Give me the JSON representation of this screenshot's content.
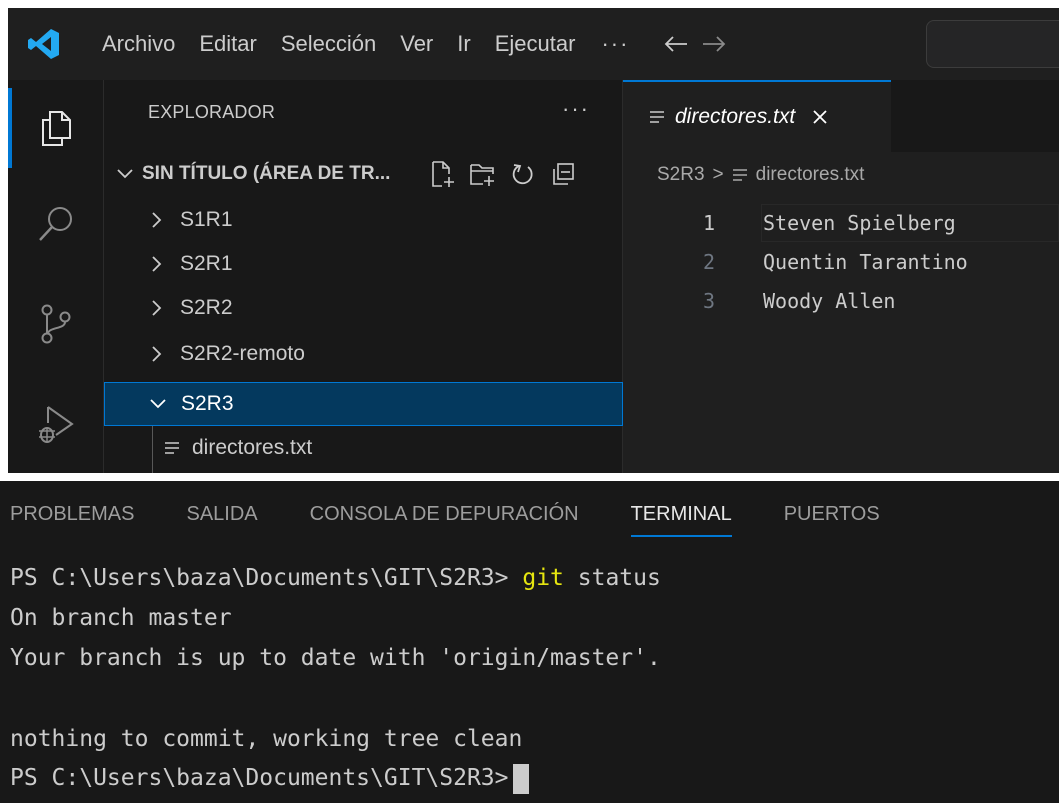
{
  "titlebar": {
    "menu": [
      "Archivo",
      "Editar",
      "Selección",
      "Ver",
      "Ir",
      "Ejecutar"
    ],
    "more": "···",
    "accent_color": "#0078d4"
  },
  "activity_bar": {
    "icons": [
      "explorer-icon",
      "search-icon",
      "source-control-icon",
      "run-debug-icon"
    ]
  },
  "explorer": {
    "header": "EXPLORADOR",
    "more": "···",
    "workspace_title": "SIN TÍTULO (ÁREA DE TR...",
    "folders": [
      "S1R1",
      "S2R1",
      "S2R2",
      "S2R2-remoto",
      "S2R3"
    ],
    "selected_folder": "S2R3",
    "open_file": "directores.txt"
  },
  "editor": {
    "tab_title": "directores.txt",
    "breadcrumb": {
      "folder": "S2R3",
      "separator": ">",
      "file": "directores.txt"
    },
    "lines": [
      {
        "number": "1",
        "text": "Steven Spielberg"
      },
      {
        "number": "2",
        "text": "Quentin Tarantino"
      },
      {
        "number": "3",
        "text": "Woody Allen"
      }
    ]
  },
  "panel": {
    "tabs": [
      "PROBLEMAS",
      "SALIDA",
      "CONSOLA DE DEPURACIÓN",
      "TERMINAL",
      "PUERTOS"
    ],
    "active_tab": "TERMINAL",
    "terminal": {
      "prompt": "PS C:\\Users\\baza\\Documents\\GIT\\S2R3>",
      "command_name": "git",
      "command_args": "status",
      "output": [
        "On branch master",
        "Your branch is up to date with 'origin/master'.",
        "",
        "nothing to commit, working tree clean"
      ],
      "final_prompt": "PS C:\\Users\\baza\\Documents\\GIT\\S2R3>"
    }
  }
}
